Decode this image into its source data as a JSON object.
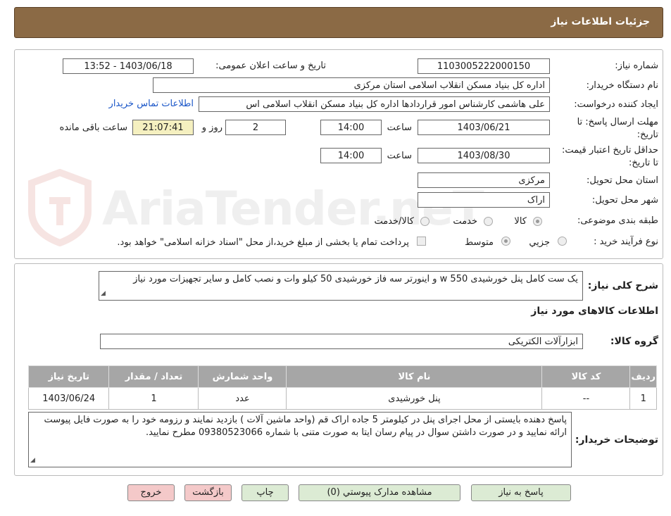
{
  "header": {
    "title": "جزئیات اطلاعات نیاز"
  },
  "labels": {
    "need_number": "شماره نیاز:",
    "announce_datetime": "تاریخ و ساعت اعلان عمومی:",
    "buyer_org": "نام دستگاه خریدار:",
    "requester": "ایجاد کننده درخواست:",
    "reply_deadline": "مهلت ارسال پاسخ: تا تاریخ:",
    "hour": "ساعت",
    "day_and": "روز و",
    "hours_remaining": "ساعت باقی مانده",
    "price_validity": "حداقل تاریخ اعتبار قیمت: تا تاریخ:",
    "delivery_province": "استان محل تحویل:",
    "delivery_city": "شهر محل تحویل:",
    "subject_class": "طبقه بندی موضوعی:",
    "purchase_type": "نوع فرآیند خرید :",
    "general_desc": "شرح کلی نیاز:",
    "goods_info": "اطلاعات کالاهای مورد نیاز",
    "goods_group": "گروه کالا:",
    "buyer_notes": "توضیحات خریدار:"
  },
  "values": {
    "need_number": "1103005222000150",
    "announce_datetime": "1403/06/18 - 13:52",
    "buyer_org": "اداره کل بنیاد مسکن انقلاب اسلامی استان مرکزی",
    "requester": "علی هاشمی کارشناس امور قراردادها اداره کل بنیاد مسکن انقلاب اسلامی اس",
    "contact_link": "اطلاعات تماس خریدار",
    "reply_date": "1403/06/21",
    "reply_time": "14:00",
    "days": "2",
    "remaining": "21:07:41",
    "validity_date": "1403/08/30",
    "validity_time": "14:00",
    "province": "مرکزی",
    "city": "اراک",
    "general_desc": "یک ست کامل پنل خورشیدی w 550 و اینورتر سه فاز خورشیدی 50 کیلو وات و نصب کامل و سایر تجهیزات مورد نیاز",
    "goods_group": "ابزارآلات الکتریکی",
    "buyer_notes": "پاسخ دهنده بایستی از محل اجرای پنل در کیلومتر 5 جاده اراک قم (واحد ماشین آلات ) بازدید نمایند و رزومه خود را به صورت فایل پیوست ارائه نمایید و در صورت داشتن سوال در پیام رسان ایتا به صورت متنی با شماره 09380523066 مطرح نمایید."
  },
  "subject_options": [
    "کالا",
    "خدمت",
    "کالا/خدمت"
  ],
  "subject_selected": "کالا",
  "purchase_options": [
    "جزیي",
    "متوسط"
  ],
  "purchase_selected": "جزیي",
  "treasury_note": "پرداخت تمام یا بخشی از مبلغ خرید،از محل \"اسناد خزانه اسلامی\" خواهد بود.",
  "table": {
    "headers": [
      "ردیف",
      "کد کالا",
      "نام کالا",
      "واحد شمارش",
      "تعداد / مقدار",
      "تاریخ نیاز"
    ],
    "rows": [
      [
        "1",
        "--",
        "پنل خورشیدی",
        "عدد",
        "1",
        "1403/06/24"
      ]
    ]
  },
  "buttons": {
    "reply": "پاسخ به نیاز",
    "attachments": "مشاهده مدارک پیوستي (0)",
    "print": "چاپ",
    "back": "بازگشت",
    "exit": "خروج"
  },
  "watermark": "AriaTender.neT",
  "colors": {
    "header_bg": "#8b6a45",
    "table_header": "#a6a6a6",
    "link": "#1a56c8"
  }
}
